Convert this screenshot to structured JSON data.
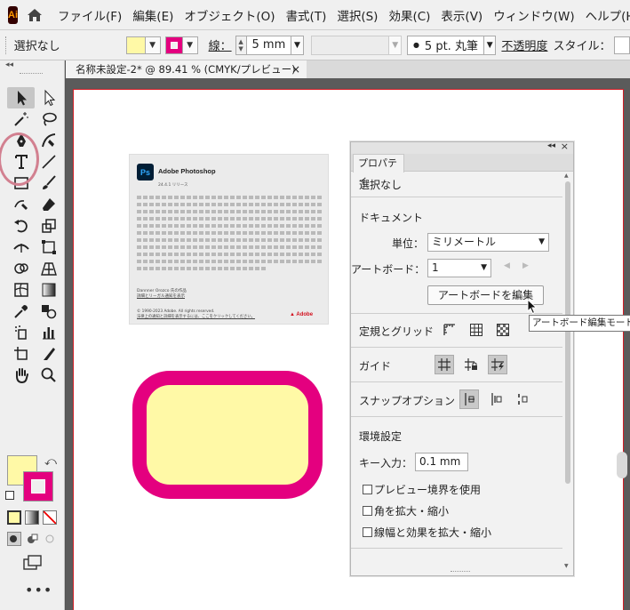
{
  "app": {
    "logo": "Ai",
    "menu": [
      "ファイル(F)",
      "編集(E)",
      "オブジェクト(O)",
      "書式(T)",
      "選択(S)",
      "効果(C)",
      "表示(V)",
      "ウィンドウ(W)",
      "ヘルプ(H"
    ]
  },
  "control": {
    "selection": "選択なし",
    "stroke_label": "線：",
    "stroke_weight": "5 mm",
    "brush": "5 pt. 丸筆",
    "opacity_label": "不透明度",
    "style_label": "スタイル："
  },
  "document": {
    "tab_title": "名称未設定-2* @ 89.41 % (CMYK/プレビュー)",
    "tab_close": "×"
  },
  "colors": {
    "fill": "#fff9a6",
    "stroke": "#e4007f",
    "artboard_border": "#d21f27"
  },
  "splash": {
    "logo": "Ps",
    "title": "Adobe Photoshop",
    "version": "24.4.1 リリース",
    "credit_line1": "Dannner Orozco 氏の作品",
    "credit_line2": "詳細とリーガル通知を表示",
    "copyright1": "© 1990-2023 Adobe. All rights reserved.",
    "copyright2": "法律上の通知と詳細を表示するには、ここをクリックしてください。",
    "adobe": "Adobe"
  },
  "properties": {
    "tab": "プロパティ",
    "selection_state": "選択なし",
    "document_header": "ドキュメント",
    "unit_label": "単位：",
    "unit_value": "ミリメートル",
    "artboard_label": "アートボード：",
    "artboard_value": "1",
    "edit_artboard_button": "アートボードを編集",
    "rulers_grid_label": "定規とグリッド",
    "guides_label": "ガイド",
    "snap_label": "スナップオプション",
    "prefs_header": "環境設定",
    "key_increment_label": "キー入力：",
    "key_increment_value": "0.1 mm",
    "check_preview_bounds": "プレビュー境界を使用",
    "check_scale_corners": "角を拡大・縮小",
    "check_scale_strokes": "線幅と効果を拡大・縮小"
  },
  "tooltip": "アートボード編集モードを"
}
